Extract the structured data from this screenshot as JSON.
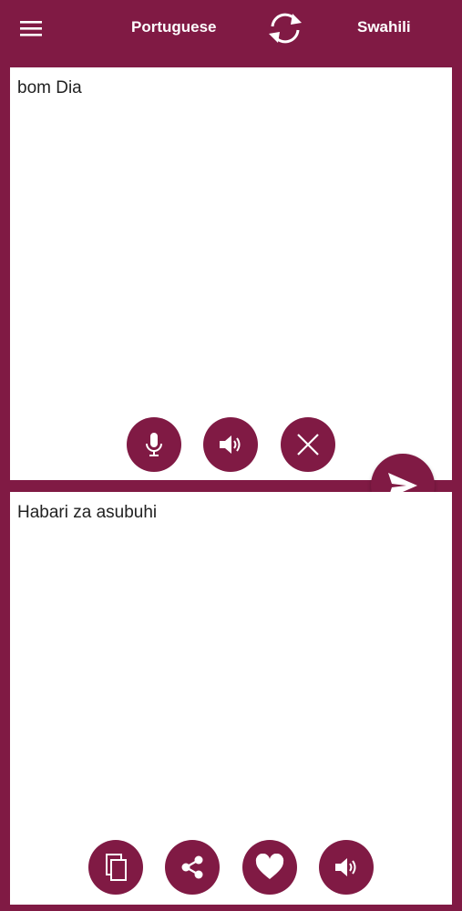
{
  "header": {
    "menu_icon": "hamburger-menu-icon",
    "source_language": "Portuguese",
    "swap_icon": "swap-languages-icon",
    "target_language": "Swahili"
  },
  "input_panel": {
    "text": "bom Dia",
    "actions": [
      {
        "name": "microphone",
        "icon": "microphone-icon"
      },
      {
        "name": "speak-input",
        "icon": "speaker-icon"
      },
      {
        "name": "clear",
        "icon": "close-icon"
      }
    ]
  },
  "translate_button": {
    "icon": "send-icon"
  },
  "output_panel": {
    "text": "Habari za asubuhi",
    "actions": [
      {
        "name": "copy",
        "icon": "copy-icon"
      },
      {
        "name": "share",
        "icon": "share-icon"
      },
      {
        "name": "favorite",
        "icon": "heart-icon"
      },
      {
        "name": "speak-output",
        "icon": "speaker-icon"
      }
    ]
  },
  "colors": {
    "brand": "#801a44",
    "panel_background": "#ffffff",
    "text": "#222222"
  }
}
